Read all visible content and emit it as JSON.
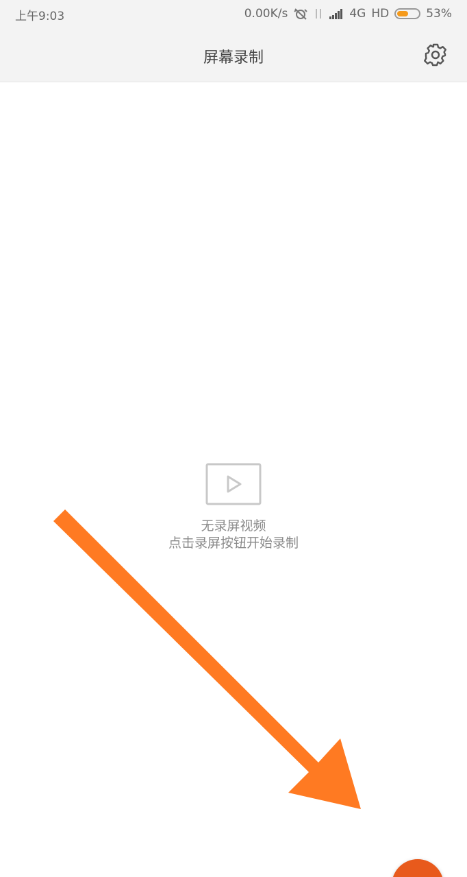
{
  "status_bar": {
    "time": "上午9:03",
    "speed": "0.00K/s",
    "network": "4G",
    "hd": "HD",
    "battery_text": "53%",
    "battery_level": 0.53,
    "battery_color": "#f59a1b"
  },
  "header": {
    "title": "屏幕录制",
    "settings_icon": "gear-icon"
  },
  "empty_state": {
    "icon": "video-play-icon",
    "title": "无录屏视频",
    "subtitle": "点击录屏按钮开始录制"
  },
  "colors": {
    "accent_arrow": "#ff7a22",
    "record_button": "#e85a1c",
    "icon_gray": "#c8c8c8"
  }
}
